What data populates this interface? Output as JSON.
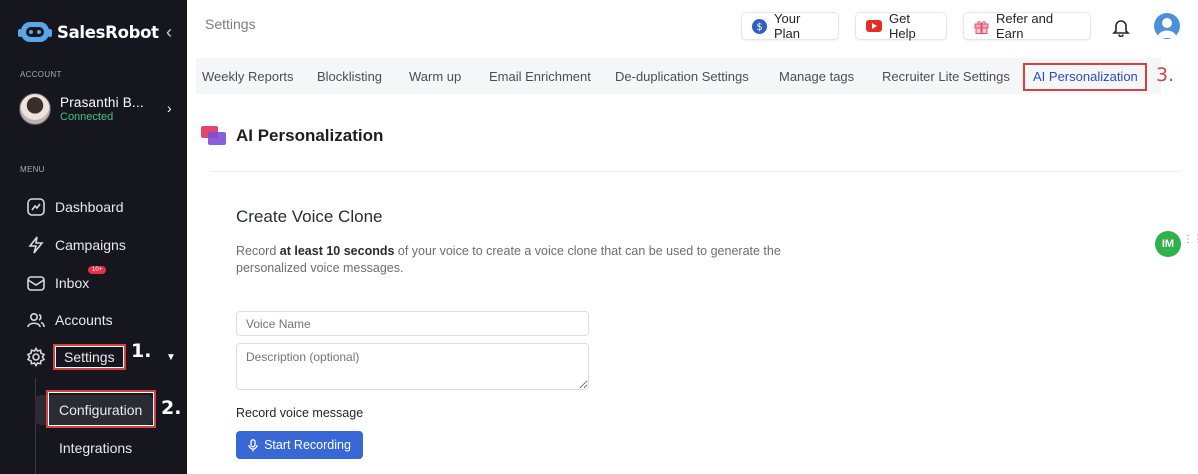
{
  "sidebar": {
    "brand": "SalesRobot",
    "collapse_icon": "chevron-left-icon",
    "account_label": "ACCOUNT",
    "account": {
      "name": "Prasanthi B...",
      "status": "Connected"
    },
    "menu_label": "MENU",
    "items": [
      {
        "label": "Dashboard",
        "icon": "dashboard-icon"
      },
      {
        "label": "Campaigns",
        "icon": "lightning-icon"
      },
      {
        "label": "Inbox",
        "icon": "inbox-icon",
        "badge": "10+"
      },
      {
        "label": "Accounts",
        "icon": "users-icon"
      },
      {
        "label": "Settings",
        "icon": "gear-icon"
      }
    ],
    "subitems": [
      {
        "label": "Configuration"
      },
      {
        "label": "Integrations"
      }
    ],
    "annotations": {
      "step1": "1.",
      "step2": "2."
    }
  },
  "header": {
    "title": "Settings",
    "your_plan": "Your Plan",
    "get_help": "Get Help",
    "refer": "Refer and Earn"
  },
  "tabs": [
    "Weekly Reports",
    "Blocklisting",
    "Warm up",
    "Email Enrichment",
    "De-duplication Settings",
    "Manage tags",
    "Recruiter Lite Settings",
    "AI Personalization"
  ],
  "annotation3": "3.",
  "section": {
    "title": "AI Personalization"
  },
  "voice_clone": {
    "title": "Create Voice Clone",
    "desc_prefix": "Record ",
    "desc_bold": "at least 10 seconds",
    "desc_suffix": " of your voice to create a voice clone that can be used to generate the personalized voice messages.",
    "name_placeholder": "Voice Name",
    "description_placeholder": "Description (optional)",
    "record_label": "Record voice message",
    "record_button": "Start Recording"
  },
  "widget": {
    "label": "IM"
  },
  "colors": {
    "sidebar_bg": "#16161e",
    "accent": "#3867d6",
    "annotation_red": "#d64141",
    "connected_green": "#47c27a",
    "active_tab": "#2f4bbd"
  }
}
